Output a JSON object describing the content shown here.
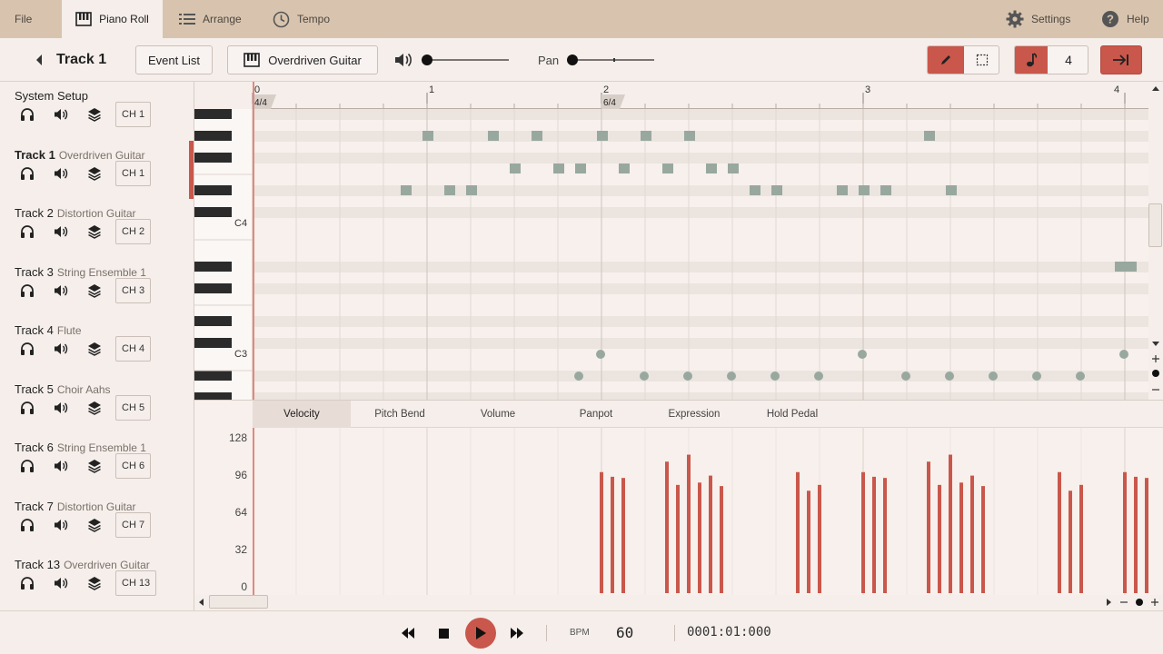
{
  "menu": {
    "file": "File",
    "piano_roll": "Piano Roll",
    "arrange": "Arrange",
    "tempo": "Tempo",
    "settings": "Settings",
    "help": "Help"
  },
  "toolbar": {
    "track_title": "Track 1",
    "event_list": "Event List",
    "instrument": "Overdriven Guitar",
    "pan_label": "Pan",
    "quantize": "4",
    "accent_color": "#c9574b"
  },
  "tracks": [
    {
      "name": "System Setup",
      "instrument": "",
      "channel": "CH 1"
    },
    {
      "name": "Track 1",
      "instrument": "Overdriven Guitar",
      "channel": "CH 1"
    },
    {
      "name": "Track 2",
      "instrument": "Distortion Guitar",
      "channel": "CH 2"
    },
    {
      "name": "Track 3",
      "instrument": "String Ensemble 1",
      "channel": "CH 3"
    },
    {
      "name": "Track 4",
      "instrument": "Flute",
      "channel": "CH 4"
    },
    {
      "name": "Track 5",
      "instrument": "Choir Aahs",
      "channel": "CH 5"
    },
    {
      "name": "Track 6",
      "instrument": "String Ensemble 1",
      "channel": "CH 6"
    },
    {
      "name": "Track 7",
      "instrument": "Distortion Guitar",
      "channel": "CH 7"
    },
    {
      "name": "Track 13",
      "instrument": "Overdriven Guitar",
      "channel": "CH 13"
    }
  ],
  "ruler": {
    "bars": [
      "0",
      "1",
      "2",
      "3",
      "4"
    ],
    "time_signatures": [
      "4/4",
      "6/4"
    ]
  },
  "keyboard": {
    "labels": [
      "C4",
      "C3"
    ]
  },
  "notes": [
    {
      "beat": 3.5,
      "row": 3
    },
    {
      "beat": 4,
      "row": 1
    },
    {
      "beat": 4.5,
      "row": 3
    },
    {
      "beat": 5,
      "row": 3
    },
    {
      "beat": 5.5,
      "row": 1
    },
    {
      "beat": 6,
      "row": 2
    },
    {
      "beat": 6.5,
      "row": 1
    },
    {
      "beat": 7,
      "row": 2
    },
    {
      "beat": 7.5,
      "row": 2
    },
    {
      "beat": 8,
      "row": 1
    },
    {
      "beat": 8.5,
      "row": 2
    },
    {
      "beat": 9,
      "row": 1
    },
    {
      "beat": 9.5,
      "row": 2
    },
    {
      "beat": 10,
      "row": 1
    },
    {
      "beat": 10.5,
      "row": 2
    },
    {
      "beat": 11,
      "row": 2
    },
    {
      "beat": 11.5,
      "row": 3
    },
    {
      "beat": 12,
      "row": 3
    },
    {
      "beat": 13.5,
      "row": 3
    },
    {
      "beat": 14,
      "row": 3
    },
    {
      "beat": 14.5,
      "row": 3
    },
    {
      "beat": 15.5,
      "row": 1
    },
    {
      "beat": 16,
      "row": 3
    }
  ],
  "drums": [
    {
      "beat": 7.5,
      "row": "low"
    },
    {
      "beat": 8,
      "row": "high"
    },
    {
      "beat": 9,
      "row": "low"
    },
    {
      "beat": 10,
      "row": "low"
    },
    {
      "beat": 11,
      "row": "low"
    },
    {
      "beat": 12,
      "row": "low"
    },
    {
      "beat": 13,
      "row": "low"
    },
    {
      "beat": 14,
      "row": "high"
    },
    {
      "beat": 15,
      "row": "low"
    },
    {
      "beat": 16,
      "row": "low"
    },
    {
      "beat": 17,
      "row": "low"
    },
    {
      "beat": 18,
      "row": "low"
    },
    {
      "beat": 19,
      "row": "low"
    },
    {
      "beat": 20,
      "row": "high"
    }
  ],
  "controllers": {
    "tabs": [
      "Velocity",
      "Pitch Bend",
      "Volume",
      "Panpot",
      "Expression",
      "Hold Pedal"
    ],
    "active": "Velocity",
    "axis_labels": [
      "128",
      "96",
      "64",
      "32",
      "0"
    ],
    "velocity": [
      {
        "beat": 8,
        "value": 104
      },
      {
        "beat": 8.25,
        "value": 100
      },
      {
        "beat": 8.5,
        "value": 99
      },
      {
        "beat": 9.5,
        "value": 113
      },
      {
        "beat": 9.75,
        "value": 93
      },
      {
        "beat": 10,
        "value": 119
      },
      {
        "beat": 10.25,
        "value": 95
      },
      {
        "beat": 10.5,
        "value": 101
      },
      {
        "beat": 10.75,
        "value": 92
      },
      {
        "beat": 12.5,
        "value": 104
      },
      {
        "beat": 12.75,
        "value": 88
      },
      {
        "beat": 13,
        "value": 93
      },
      {
        "beat": 14,
        "value": 104
      },
      {
        "beat": 14.25,
        "value": 100
      },
      {
        "beat": 14.5,
        "value": 99
      },
      {
        "beat": 15.5,
        "value": 113
      },
      {
        "beat": 15.75,
        "value": 93
      },
      {
        "beat": 16,
        "value": 119
      },
      {
        "beat": 16.25,
        "value": 95
      },
      {
        "beat": 16.5,
        "value": 101
      },
      {
        "beat": 16.75,
        "value": 92
      },
      {
        "beat": 18.5,
        "value": 104
      },
      {
        "beat": 18.75,
        "value": 88
      },
      {
        "beat": 19,
        "value": 93
      },
      {
        "beat": 20,
        "value": 104
      },
      {
        "beat": 20.25,
        "value": 100
      },
      {
        "beat": 20.5,
        "value": 99
      }
    ]
  },
  "transport": {
    "bpm_label": "BPM",
    "bpm": "60",
    "position": "0001:01:000"
  }
}
